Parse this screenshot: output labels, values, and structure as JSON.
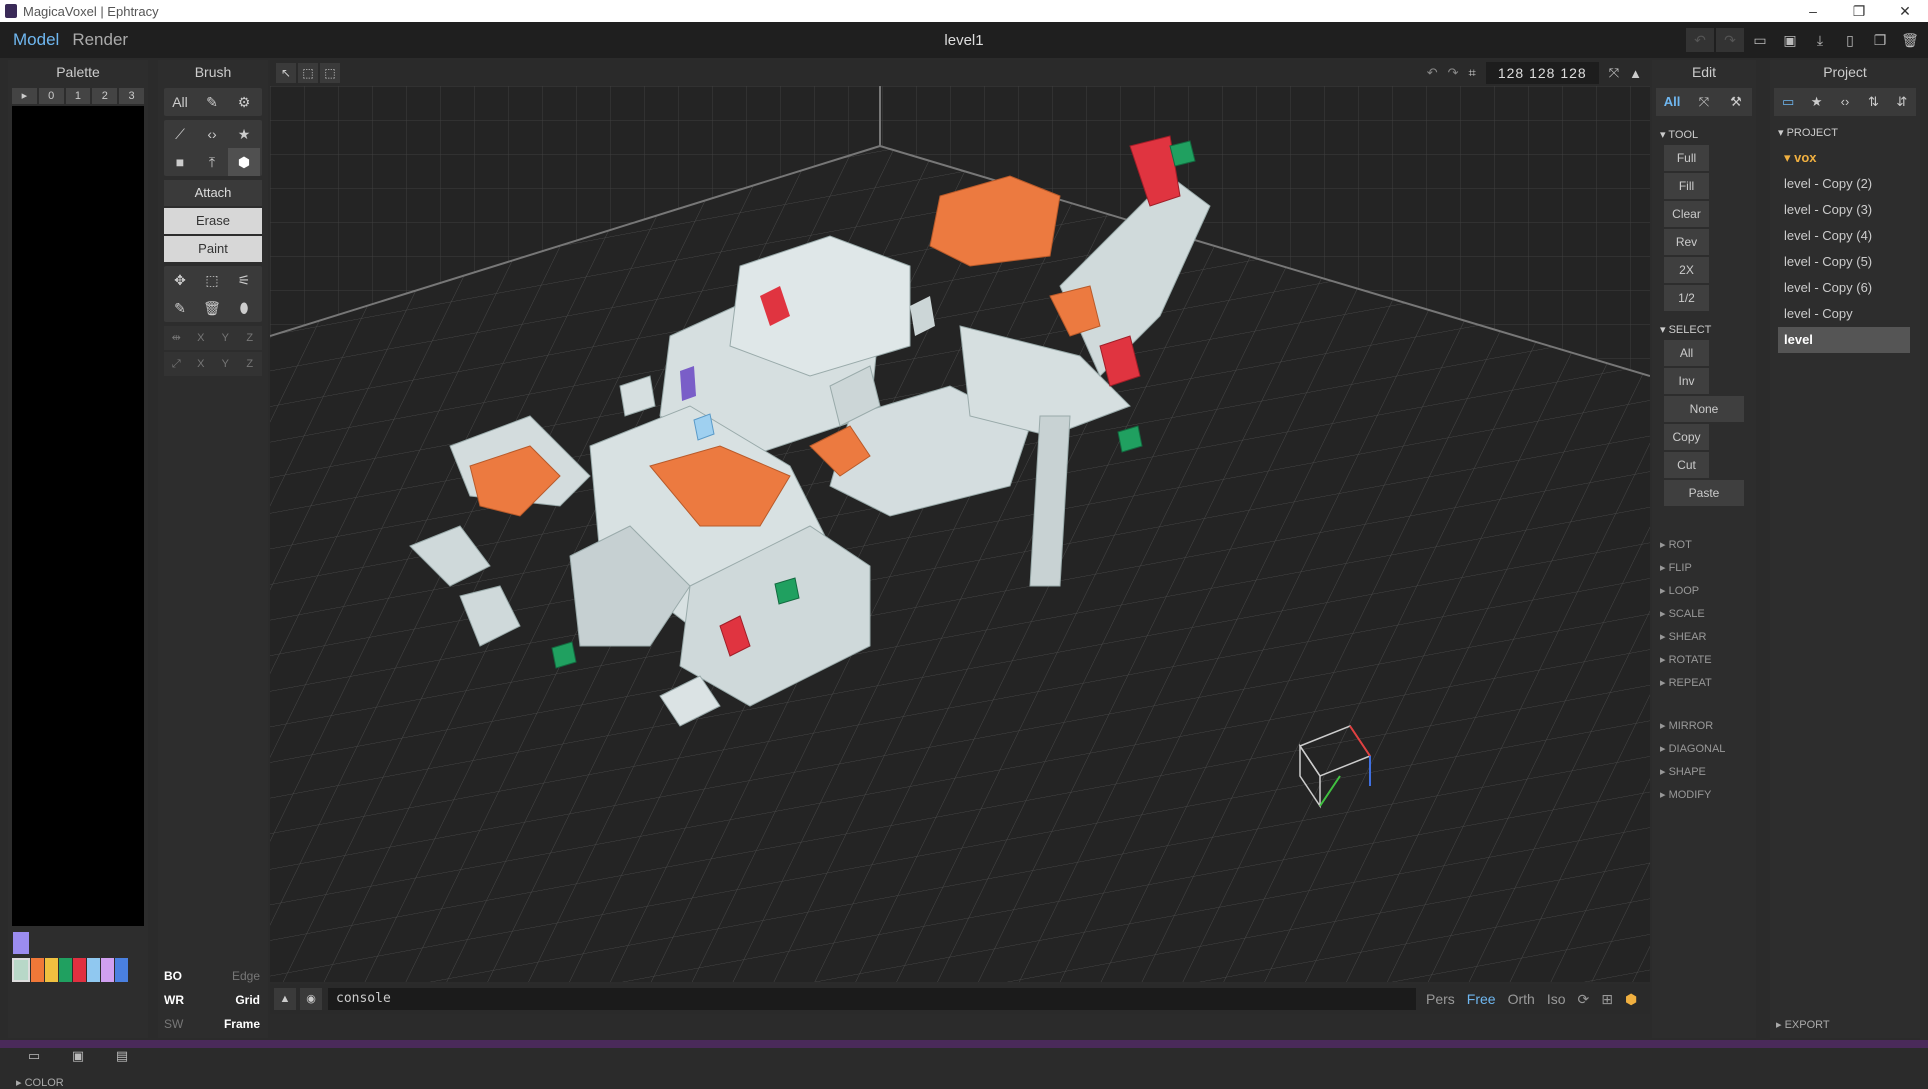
{
  "window": {
    "title": "MagicaVoxel | Ephtracy",
    "controls": [
      "–",
      "❐",
      "✕"
    ]
  },
  "menu": {
    "model": "Model",
    "render": "Render",
    "document": "level1"
  },
  "palette": {
    "title": "Palette",
    "tabs": [
      "▸",
      "0",
      "1",
      "2",
      "3"
    ],
    "swatches": [
      "#b8d8c8",
      "#f07838",
      "#f0c040",
      "#20a060",
      "#e03040",
      "#90c8f0",
      "#d0a0f0",
      "#4a80e0"
    ],
    "buttons": [
      "▭",
      "▣",
      "▤"
    ],
    "color_label": "▸ COLOR"
  },
  "brush": {
    "title": "Brush",
    "mode_icons": [
      "All",
      "✎",
      "⚙"
    ],
    "shape_icons": [
      "⟋",
      "‹›",
      "★",
      "■",
      "⤒",
      "⬢"
    ],
    "actions": {
      "attach": "Attach",
      "erase": "Erase",
      "paint": "Paint"
    },
    "tool_icons": [
      "✥",
      "⬚",
      "⚟",
      "✎",
      "🗑",
      "⬮"
    ],
    "axis_rows": [
      [
        "⇹",
        "X",
        "Y",
        "Z"
      ],
      [
        "⤢",
        "X",
        "Y",
        "Z"
      ]
    ],
    "view": [
      [
        "BO",
        "Edge"
      ],
      [
        "WR",
        "Grid"
      ],
      [
        "SW",
        "Frame"
      ]
    ]
  },
  "viewport": {
    "tool_icons": [
      "↖",
      "⬚",
      "⬚"
    ],
    "undo": "↶",
    "redo": "↷",
    "crop": "⌗",
    "size": "128  128  128",
    "fit": "⤧",
    "up": "▲"
  },
  "console": {
    "placeholder": "console",
    "up": "▲",
    "camera": "◉",
    "modes": [
      "Pers",
      "Free",
      "Orth",
      "Iso"
    ],
    "current_mode": "Free",
    "icons": [
      "⟳",
      "⊞",
      "⬢"
    ]
  },
  "edit": {
    "title": "Edit",
    "top": [
      "All",
      "⤧",
      "⚒"
    ],
    "tool_label": "▾ TOOL",
    "tool_buttons": [
      "Full",
      "Fill",
      "Clear",
      "Rev",
      "2X",
      "1/2"
    ],
    "select_label": "▾ SELECT",
    "select_buttons": [
      "All",
      "Inv"
    ],
    "none": "None",
    "copy": "Copy",
    "cut": "Cut",
    "paste": "Paste",
    "sections": [
      "▸ ROT",
      "▸ FLIP",
      "▸ LOOP",
      "▸ SCALE",
      "▸ SHEAR",
      "▸ ROTATE",
      "▸ REPEAT",
      "▸ MIRROR",
      "▸ DIAGONAL",
      "▸ SHAPE",
      "▸ MODIFY"
    ]
  },
  "project": {
    "title": "Project",
    "top": [
      "▭",
      "★",
      "‹›",
      "⇅",
      "⇵"
    ],
    "label": "▾ PROJECT",
    "folder": "▾ vox",
    "items": [
      "level - Copy (2)",
      "level - Copy (3)",
      "level - Copy (4)",
      "level - Copy (5)",
      "level - Copy (6)",
      "level - Copy",
      "level"
    ],
    "export": "▸ EXPORT"
  }
}
